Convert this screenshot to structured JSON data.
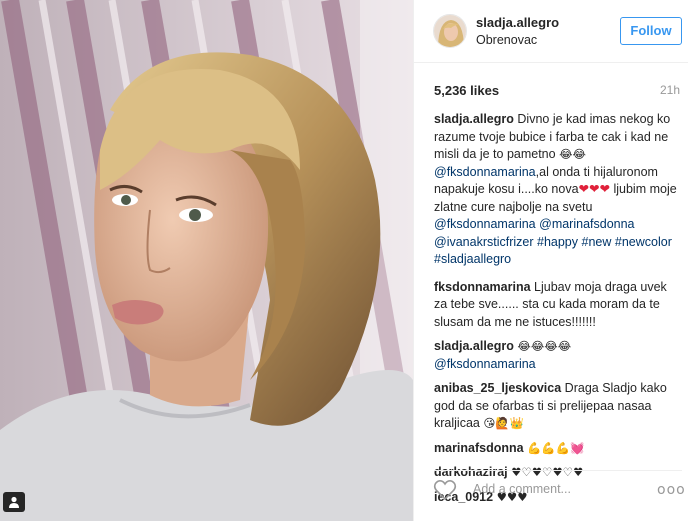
{
  "header": {
    "username": "sladja.allegro",
    "location": "Obrenovac",
    "follow_label": "Follow"
  },
  "stats": {
    "likes": "5,236 likes",
    "time": "21h"
  },
  "caption": {
    "author": "sladja.allegro",
    "text1": "Divno je kad imas nekog ko razume tvoje bubice i farba te cak i kad ne misli da je to pametno",
    "emoji1": "😂😂",
    "mention1": "@fksdonnamarina",
    "text2": ",al onda ti hijaluronom napakuje kosu i....ko nova",
    "text3": "ljubim moje zlatne cure najbolje na svetu",
    "mention2": "@fksdonnamarina",
    "mention3": "@marinafsdonna",
    "mention4": "@ivanakrsticfrizer",
    "tag1": "#happy",
    "tag2": "#new",
    "tag3": "#newcolor",
    "tag4": "#sladjaallegro"
  },
  "comments": [
    {
      "author": "fksdonnamarina",
      "text": "Ljubav moja draga uvek za tebe sve...... sta cu kada moram da te slusam da me ne istuces!!!!!!!"
    },
    {
      "author": "sladja.allegro",
      "emoji": "😂😂😂😂",
      "mention": "@fksdonnamarina"
    },
    {
      "author": "anibas_25_ljeskovica",
      "text": "Draga Sladjo kako god da se ofarbas ti si prelijepaa nasaa kraljicaa",
      "emoji": "😘🙋👑"
    },
    {
      "author": "marinafsdonna",
      "emoji": "💪💪💪💓"
    },
    {
      "author": "darkohaziraj",
      "text": "♥♡♥♡♥♡♥"
    },
    {
      "author": "ieca_0912",
      "text": "♥♥♥"
    }
  ],
  "add_comment": {
    "placeholder": "Add a comment...",
    "more": "ooo"
  },
  "colors": {
    "link": "#003569",
    "follow_blue": "#3897f0",
    "heart_red": "#e0213a"
  },
  "icons": {
    "like": "heart-outline-icon",
    "more": "ellipsis-icon",
    "tagged_user": "user-tag-icon"
  }
}
